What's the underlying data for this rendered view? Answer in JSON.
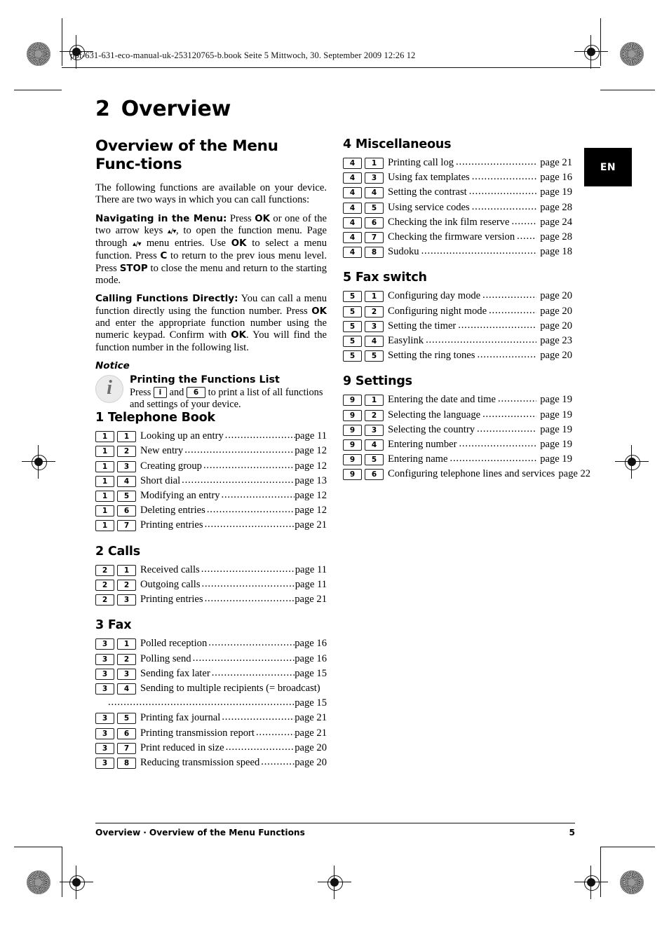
{
  "book_header": "ppf-631-631-eco-manual-uk-253120765-b.book  Seite 5  Mittwoch, 30. September 2009  12:26 12",
  "chapter": {
    "number": "2",
    "title": "Overview"
  },
  "lang_tab": "EN",
  "intro": {
    "heading": "Overview of the Menu Func-­tions",
    "paragraph1": "The following functions are available on your device. There are two ways in which you can call functions:",
    "nav": {
      "lead": "Navigating in the Menu:",
      "t1": " Press ",
      "k1": "OK",
      "t2": " or one of the two arrow keys ",
      "a1": "▴/▾",
      "t3": ", to open the function menu. Page through ",
      "a2": "▴/▾",
      "t4": " menu entries. Use ",
      "k2": "OK",
      "t5": " to select a menu function. Press ",
      "k3": "C",
      "t6": " to return to the prev ious menu level. Press ",
      "k4": "STOP",
      "t7": " to close the menu and return to the starting mode."
    },
    "direct": {
      "lead": "Calling Functions Directly:",
      "t1": " You can call a menu function directly using the function number. Press ",
      "k1": "OK",
      "t2": " and enter the appropriate function number using the numeric keypad. Confirm with ",
      "k2": "OK",
      "t3": ". You will find the function number in the following list."
    }
  },
  "notice": {
    "label": "Notice",
    "icon": "info-icon",
    "icon_glyph": "i",
    "heading": "Printing the Functions List",
    "text_part1": "Press ",
    "key1": "i",
    "text_part2": " and ",
    "key2": "6",
    "text_part3": " to print a list of all functions and settings of your device."
  },
  "page_word": "page",
  "sections": [
    {
      "column": "left",
      "title": "1 Telephone Book",
      "items": [
        {
          "k1": "1",
          "k2": "1",
          "label": "Looking up an entry",
          "page": "page 11"
        },
        {
          "k1": "1",
          "k2": "2",
          "label": "New entry",
          "page": "page 12"
        },
        {
          "k1": "1",
          "k2": "3",
          "label": "Creating group",
          "page": "page 12"
        },
        {
          "k1": "1",
          "k2": "4",
          "label": "Short dial",
          "page": "page 13"
        },
        {
          "k1": "1",
          "k2": "5",
          "label": "Modifying an entry",
          "page": "page 12"
        },
        {
          "k1": "1",
          "k2": "6",
          "label": "Deleting entries",
          "page": "page 12"
        },
        {
          "k1": "1",
          "k2": "7",
          "label": "Printing entries",
          "page": "page 21"
        }
      ]
    },
    {
      "column": "left",
      "title": "2 Calls",
      "items": [
        {
          "k1": "2",
          "k2": "1",
          "label": "Received calls",
          "page": "page 11"
        },
        {
          "k1": "2",
          "k2": "2",
          "label": "Outgoing calls",
          "page": "page 11"
        },
        {
          "k1": "2",
          "k2": "3",
          "label": "Printing entries",
          "page": "page 21"
        }
      ]
    },
    {
      "column": "left",
      "title": "3 Fax",
      "items": [
        {
          "k1": "3",
          "k2": "1",
          "label": "Polled reception",
          "page": "page 16"
        },
        {
          "k1": "3",
          "k2": "2",
          "label": "Polling send",
          "page": "page 16"
        },
        {
          "k1": "3",
          "k2": "3",
          "label": "Sending fax later",
          "page": "page 15"
        },
        {
          "k1": "3",
          "k2": "4",
          "label": "Sending to multiple recipients (= broadcast)",
          "page": "page 15",
          "wrap": true
        },
        {
          "k1": "3",
          "k2": "5",
          "label": "Printing fax journal",
          "page": "page 21"
        },
        {
          "k1": "3",
          "k2": "6",
          "label": "Printing transmission report",
          "page": "page 21"
        },
        {
          "k1": "3",
          "k2": "7",
          "label": "Print reduced in size",
          "page": "page 20"
        },
        {
          "k1": "3",
          "k2": "8",
          "label": "Reducing transmission speed",
          "page": "page 20"
        }
      ]
    },
    {
      "column": "right",
      "title": "4 Miscellaneous",
      "items": [
        {
          "k1": "4",
          "k2": "1",
          "label": "Printing call log",
          "page": "page 21"
        },
        {
          "k1": "4",
          "k2": "3",
          "label": "Using fax templates",
          "page": "page 16"
        },
        {
          "k1": "4",
          "k2": "4",
          "label": "Setting the contrast",
          "page": "page 19"
        },
        {
          "k1": "4",
          "k2": "5",
          "label": "Using service codes",
          "page": "page 28"
        },
        {
          "k1": "4",
          "k2": "6",
          "label": "Checking the ink film reserve",
          "page": "page 24"
        },
        {
          "k1": "4",
          "k2": "7",
          "label": "Checking the firmware version",
          "page": "page 28"
        },
        {
          "k1": "4",
          "k2": "8",
          "label": "Sudoku",
          "page": "page 18"
        }
      ]
    },
    {
      "column": "right",
      "title": "5 Fax switch",
      "items": [
        {
          "k1": "5",
          "k2": "1",
          "label": "Configuring day mode",
          "page": "page 20"
        },
        {
          "k1": "5",
          "k2": "2",
          "label": "Configuring night mode",
          "page": "page 20"
        },
        {
          "k1": "5",
          "k2": "3",
          "label": "Setting the timer",
          "page": "page 20"
        },
        {
          "k1": "5",
          "k2": "4",
          "label": "Easylink",
          "page": "page 23"
        },
        {
          "k1": "5",
          "k2": "5",
          "label": "Setting the ring tones",
          "page": "page 20"
        }
      ]
    },
    {
      "column": "right",
      "title": "9 Settings",
      "items": [
        {
          "k1": "9",
          "k2": "1",
          "label": "Entering the date and time",
          "page": "page 19"
        },
        {
          "k1": "9",
          "k2": "2",
          "label": "Selecting the language",
          "page": "page 19"
        },
        {
          "k1": "9",
          "k2": "3",
          "label": "Selecting the country",
          "page": "page 19"
        },
        {
          "k1": "9",
          "k2": "4",
          "label": "Entering number",
          "page": "page 19"
        },
        {
          "k1": "9",
          "k2": "5",
          "label": "Entering name",
          "page": "page 19"
        },
        {
          "k1": "9",
          "k2": "6",
          "label": "Configuring telephone lines and services",
          "page": "page 22",
          "nodots": true
        }
      ]
    }
  ],
  "footer": {
    "left": "Overview",
    "separator": "·",
    "middle": "Overview of the Menu Functions",
    "page_number": "5"
  }
}
